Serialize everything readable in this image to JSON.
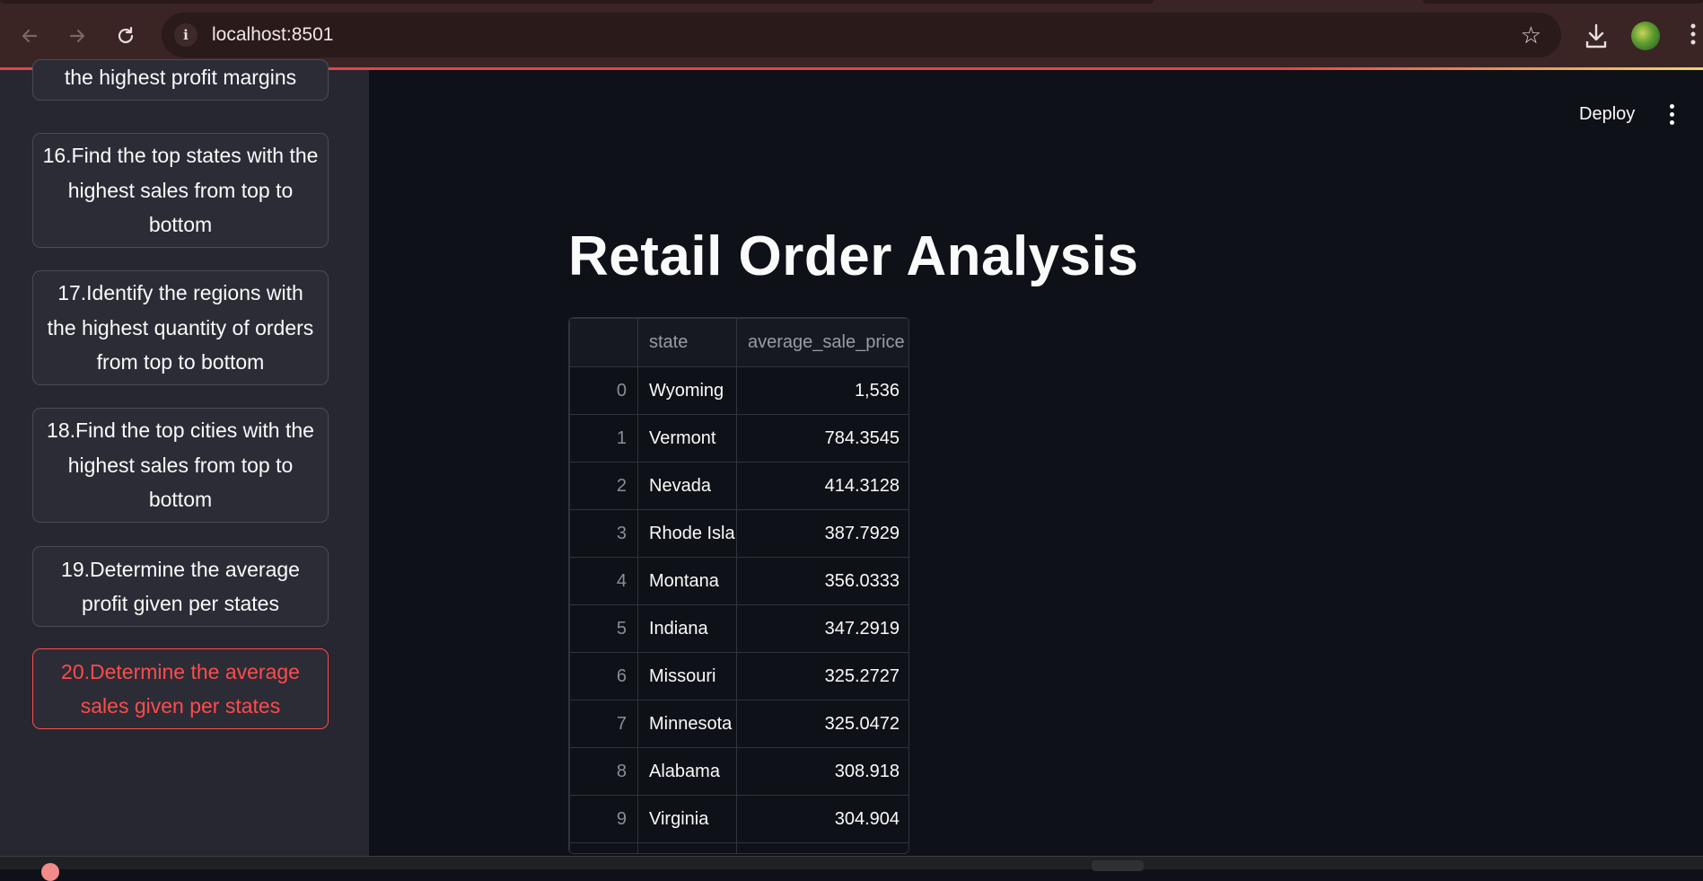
{
  "browser": {
    "url": "localhost:8501"
  },
  "header": {
    "deploy_label": "Deploy"
  },
  "sidebar": {
    "items": [
      {
        "label": "the highest profit margins",
        "active": false
      },
      {
        "label": "16.Find the top states with the highest sales from top to bottom",
        "active": false
      },
      {
        "label": "17.Identify the regions with the highest quantity of orders from top to bottom",
        "active": false
      },
      {
        "label": "18.Find the top cities with the highest sales from top to bottom",
        "active": false
      },
      {
        "label": "19.Determine the average profit given per states",
        "active": false
      },
      {
        "label": "20.Determine the average sales given per states",
        "active": true
      }
    ]
  },
  "main": {
    "title": "Retail Order Analysis",
    "table": {
      "columns": [
        "",
        "state",
        "average_sale_price"
      ],
      "rows": [
        [
          "0",
          "Wyoming",
          "1,536"
        ],
        [
          "1",
          "Vermont",
          "784.3545"
        ],
        [
          "2",
          "Nevada",
          "414.3128"
        ],
        [
          "3",
          "Rhode Island",
          "387.7929"
        ],
        [
          "4",
          "Montana",
          "356.0333"
        ],
        [
          "5",
          "Indiana",
          "347.2919"
        ],
        [
          "6",
          "Missouri",
          "325.2727"
        ],
        [
          "7",
          "Minnesota",
          "325.0472"
        ],
        [
          "8",
          "Alabama",
          "308.918"
        ],
        [
          "9",
          "Virginia",
          "304.904"
        ]
      ]
    }
  },
  "colors": {
    "accent": "#ff4b4b",
    "background": "#0e1117",
    "sidebar": "#262730"
  }
}
